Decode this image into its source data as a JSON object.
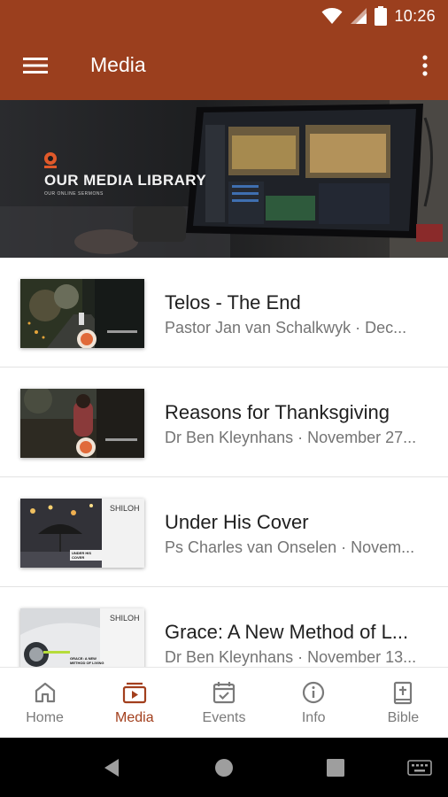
{
  "status_bar": {
    "time": "10:26",
    "icons": [
      "wifi-icon",
      "signal-icon",
      "battery-icon"
    ]
  },
  "app_bar": {
    "title": "Media",
    "menu_icon": "hamburger-menu-icon",
    "overflow_icon": "more-vert-icon"
  },
  "banner": {
    "title": "OUR MEDIA LIBRARY",
    "subtitle": "OUR ONLINE SERMONS"
  },
  "media_items": [
    {
      "title": "Telos - The End",
      "subtitle": "Pastor Jan van Schalkwyk · Dec..."
    },
    {
      "title": "Reasons for Thanksgiving",
      "subtitle": "Dr Ben Kleynhans · November 27..."
    },
    {
      "title": "Under His Cover",
      "subtitle": "Ps Charles van Onselen · Novem...",
      "thumb_text": "UNDER HIS COVER",
      "thumb_brand": "SHILOH"
    },
    {
      "title": "Grace: A New Method of L...",
      "subtitle": "Dr Ben Kleynhans · November 13...",
      "thumb_text": "GRACE: A NEW METHOD OF LIVING",
      "thumb_brand": "SHILOH"
    }
  ],
  "bottom_nav": [
    {
      "label": "Home",
      "icon": "home-icon"
    },
    {
      "label": "Media",
      "icon": "media-icon",
      "active": true
    },
    {
      "label": "Events",
      "icon": "calendar-check-icon"
    },
    {
      "label": "Info",
      "icon": "info-icon"
    },
    {
      "label": "Bible",
      "icon": "bible-icon"
    }
  ],
  "colors": {
    "primary": "#9b3f1e",
    "active": "#a23f1d",
    "inactive": "#7a7a7a"
  }
}
